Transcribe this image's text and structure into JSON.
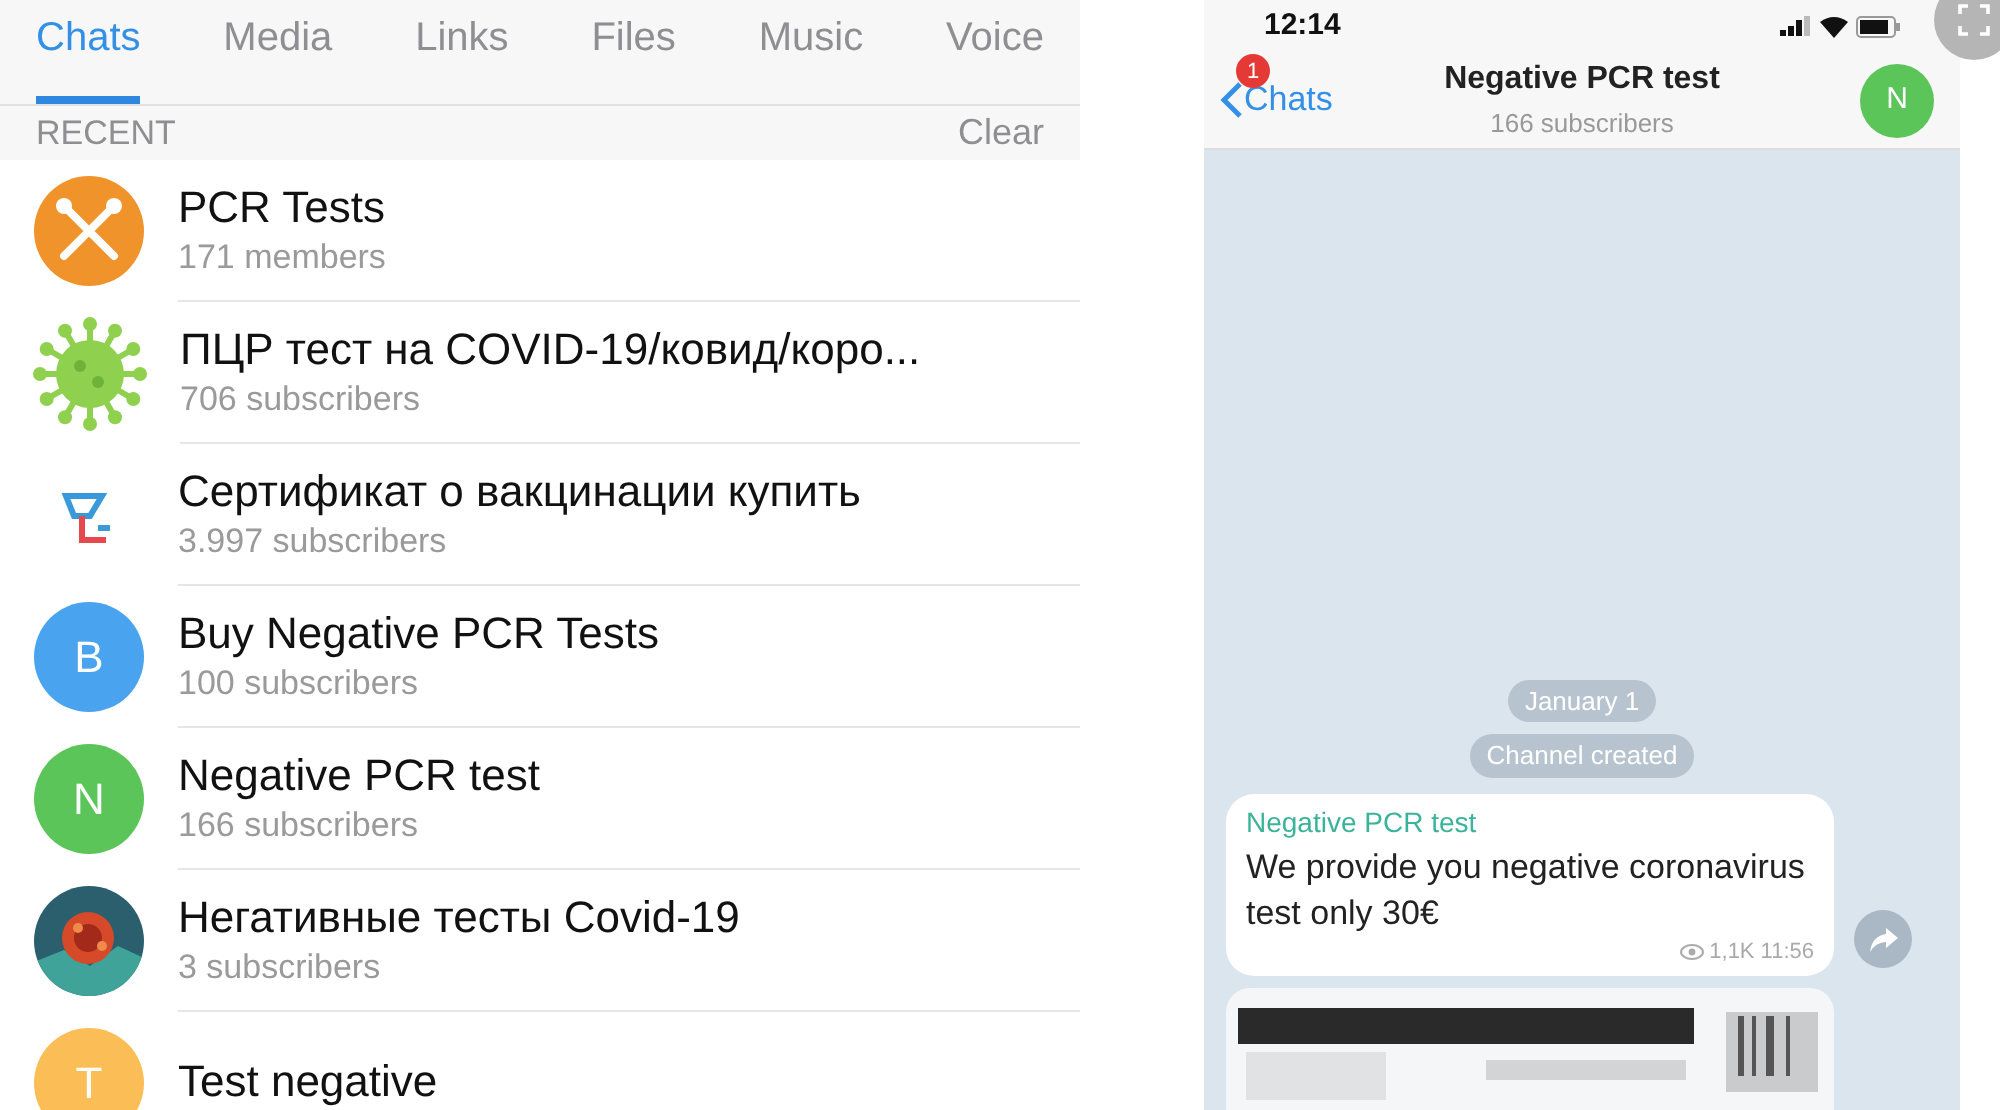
{
  "tabs": [
    {
      "label": "Chats",
      "selected": true
    },
    {
      "label": "Media",
      "selected": false
    },
    {
      "label": "Links",
      "selected": false
    },
    {
      "label": "Files",
      "selected": false
    },
    {
      "label": "Music",
      "selected": false
    },
    {
      "label": "Voice",
      "selected": false
    }
  ],
  "section": {
    "title": "RECENT",
    "action": "Clear"
  },
  "results": [
    {
      "kind": "swab",
      "name": "PCR Tests",
      "subtitle": "171 members",
      "color": "#f0932b"
    },
    {
      "kind": "virus",
      "name": "ПЦР тест на COVID-19/ковид/коро...",
      "subtitle": "706 subscribers",
      "color": "#8fd14f"
    },
    {
      "kind": "logo",
      "name": "Сертификат о вакцинации купить",
      "subtitle": "3.997 subscribers"
    },
    {
      "kind": "letter",
      "initial": "B",
      "name": "Buy Negative PCR Tests",
      "subtitle": "100 subscribers",
      "color": "#4aa3ee"
    },
    {
      "kind": "letter",
      "initial": "N",
      "name": "Negative PCR test",
      "subtitle": "166 subscribers",
      "color": "#5bc55a"
    },
    {
      "kind": "picture",
      "name": "Негативные тесты Covid-19",
      "subtitle": "3 subscribers"
    },
    {
      "kind": "letter",
      "initial": "T",
      "name": "Test negative",
      "color": "#fbbd55"
    }
  ],
  "phone": {
    "time": "12:14",
    "back": {
      "label": "Chats",
      "badge": "1"
    },
    "title": "Negative PCR test",
    "subtitle": "166 subscribers",
    "avatar": {
      "initial": "N",
      "color": "#5bc55a"
    },
    "service": [
      "January 1",
      "Channel created"
    ],
    "message": {
      "author": "Negative PCR test",
      "text": "We provide you negative coronavirus test only 30€",
      "views": "1,1K",
      "time": "11:56"
    }
  }
}
